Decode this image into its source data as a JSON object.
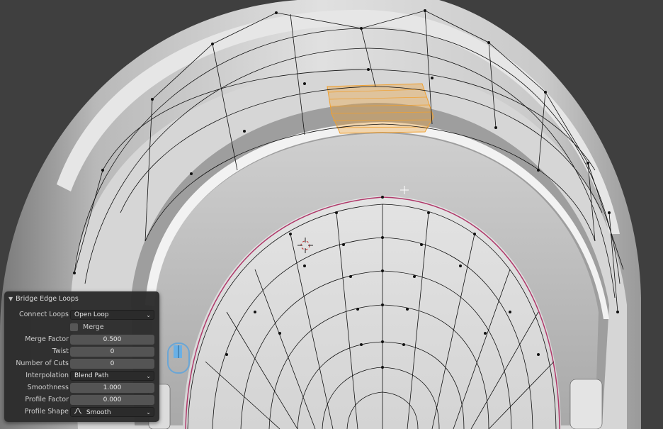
{
  "panel": {
    "title": "Bridge Edge Loops",
    "fields": {
      "connect_loops": {
        "label": "Connect Loops",
        "value": "Open Loop"
      },
      "merge": {
        "label": "Merge",
        "checked": false
      },
      "merge_factor": {
        "label": "Merge Factor",
        "value": "0.500"
      },
      "twist": {
        "label": "Twist",
        "value": "0"
      },
      "number_of_cuts": {
        "label": "Number of Cuts",
        "value": "0"
      },
      "interpolation": {
        "label": "Interpolation",
        "value": "Blend Path"
      },
      "smoothness": {
        "label": "Smoothness",
        "value": "1.000"
      },
      "profile_factor": {
        "label": "Profile Factor",
        "value": "0.000"
      },
      "profile_shape": {
        "label": "Profile Shape",
        "value": "Smooth"
      }
    }
  },
  "icons": {
    "panel_collapse": "chevron-down-icon",
    "dropdown": "chevron-down-icon",
    "profile_shape": "smooth-curve-icon",
    "mouse": "mouse-icon",
    "cursor": "3d-cursor-icon"
  },
  "colors": {
    "viewport_bg": "#3f3f3f",
    "mesh_surface": "#d9d9d9",
    "wire": "#111111",
    "selection": "#f0a030",
    "seam": "#b0386a",
    "panel_bg": "#2c2c2c"
  }
}
